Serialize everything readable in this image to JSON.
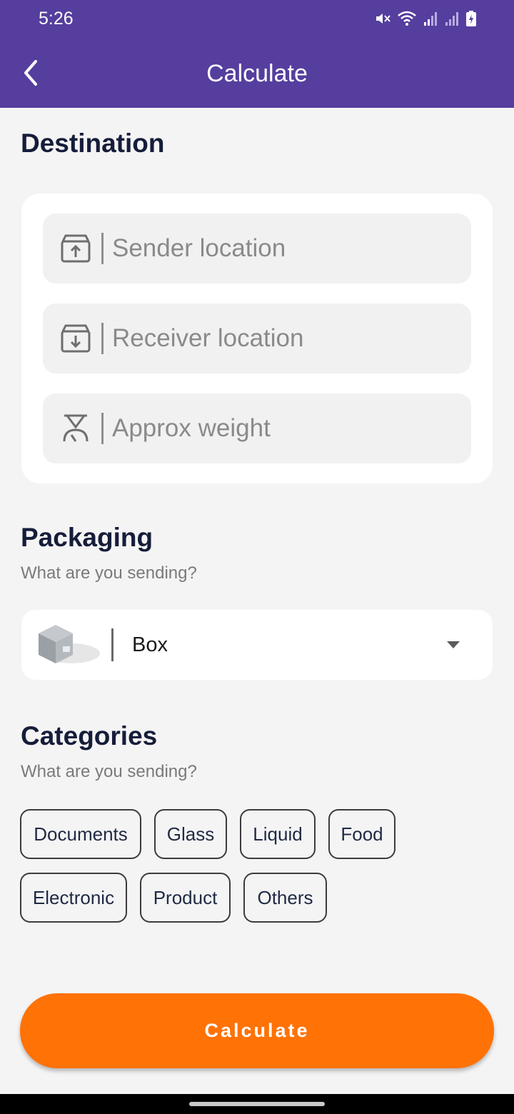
{
  "status_bar": {
    "time": "5:26",
    "icons": [
      "mute-icon",
      "wifi-icon",
      "signal-icon",
      "signal-icon",
      "battery-charging-icon"
    ]
  },
  "appbar": {
    "title": "Calculate",
    "back_icon": "chevron-left-icon",
    "background": "#553e9e"
  },
  "destination": {
    "title": "Destination",
    "fields": [
      {
        "icon": "box-upload-icon",
        "placeholder": "Sender location"
      },
      {
        "icon": "box-download-icon",
        "placeholder": "Receiver location"
      },
      {
        "icon": "scale-icon",
        "placeholder": "Approx weight"
      }
    ]
  },
  "packaging": {
    "title": "Packaging",
    "subtitle": "What are you sending?",
    "selected": "Box",
    "icon": "package-box-icon"
  },
  "categories": {
    "title": "Categories",
    "subtitle": "What are you sending?",
    "items": [
      "Documents",
      "Glass",
      "Liquid",
      "Food",
      "Electronic",
      "Product",
      "Others"
    ]
  },
  "action": {
    "label": "Calculate",
    "color": "#ff7206"
  }
}
